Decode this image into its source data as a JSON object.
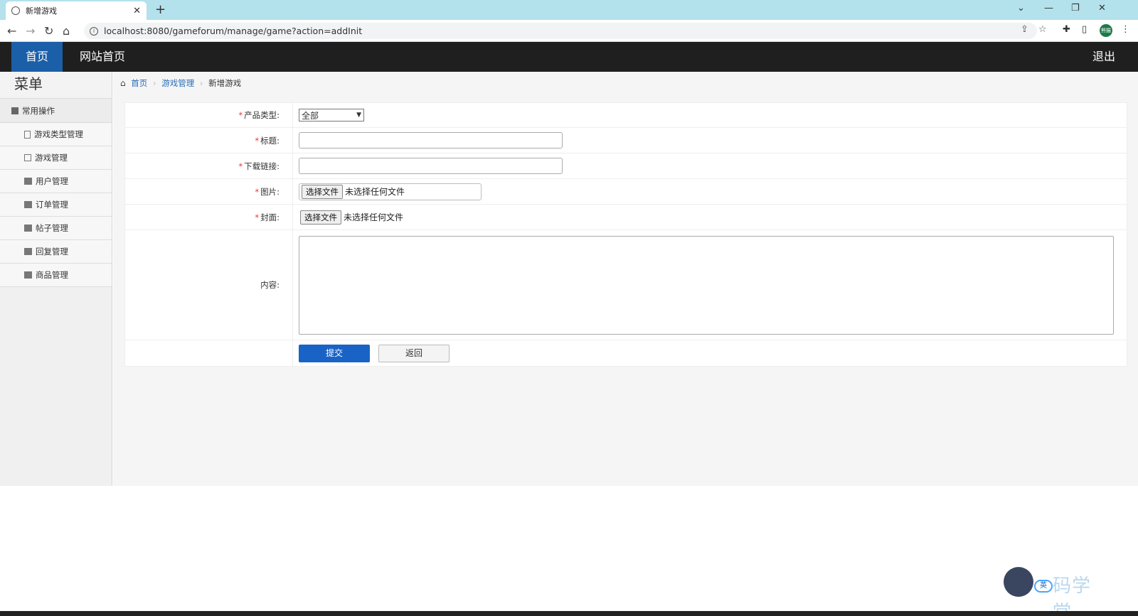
{
  "browser": {
    "tab_title": "新增游戏",
    "tab_close": "✕",
    "new_tab": "+",
    "url": "localhost:8080/gameforum/manage/game?action=addInit",
    "profile_label": "熊猫"
  },
  "header": {
    "nav": [
      {
        "label": "首页",
        "active": true
      },
      {
        "label": "网站首页",
        "active": false
      }
    ],
    "logout": "退出"
  },
  "sidebar": {
    "title": "菜单",
    "group": "常用操作",
    "items": [
      {
        "label": "游戏类型管理",
        "icon": "file-icon"
      },
      {
        "label": "游戏管理",
        "icon": "list-icon"
      },
      {
        "label": "用户管理",
        "icon": "folder-icon"
      },
      {
        "label": "订单管理",
        "icon": "folder-icon"
      },
      {
        "label": "帖子管理",
        "icon": "folder-icon"
      },
      {
        "label": "回复管理",
        "icon": "folder-icon"
      },
      {
        "label": "商品管理",
        "icon": "folder-icon"
      }
    ]
  },
  "breadcrumb": {
    "home": "首页",
    "section": "游戏管理",
    "current": "新增游戏"
  },
  "form": {
    "required_mark": "*",
    "product_type_label": "产品类型:",
    "product_type_value": "全部",
    "title_label": "标题:",
    "download_label": "下载链接:",
    "image_label": "图片:",
    "cover_label": "封面:",
    "file_button": "选择文件",
    "file_none": "未选择任何文件",
    "content_label": "内容:",
    "submit": "提交",
    "back": "返回"
  },
  "watermark": {
    "badge": "英",
    "text": "码学堂"
  }
}
